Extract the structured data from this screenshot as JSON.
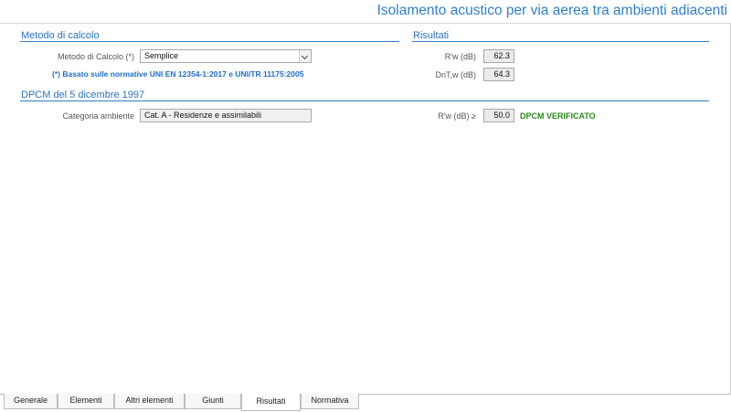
{
  "header": {
    "title": "Isolamento acustico per via aerea tra ambienti adiacenti"
  },
  "metodo": {
    "section_title": "Metodo di calcolo",
    "label": "Metodo di Calcolo (*)",
    "value": "Semplice",
    "note": "(*) Basato sulle normative UNI EN 12354-1:2017 e UNI/TR 11175:2005"
  },
  "risultati": {
    "section_title": "Risultati",
    "rw_label": "R'w (dB)",
    "rw_value": "62.3",
    "dnt_label": "DnT,w (dB)",
    "dnt_value": "64.3"
  },
  "dpcm": {
    "section_title": "DPCM del 5 dicembre 1997",
    "categoria_label": "Categoria ambiente",
    "categoria_value": "Cat. A - Residenze e assimilabili",
    "req_label": "R'w (dB) ≥",
    "req_value": "50.0",
    "status": "DPCM VERIFICATO",
    "status_color": "#2a8a1a"
  },
  "tabs": [
    {
      "label": "Generale"
    },
    {
      "label": "Elementi"
    },
    {
      "label": "Altri elementi"
    },
    {
      "label": "Giunti"
    },
    {
      "label": "Risultati",
      "active": true
    },
    {
      "label": "Normativa"
    }
  ]
}
